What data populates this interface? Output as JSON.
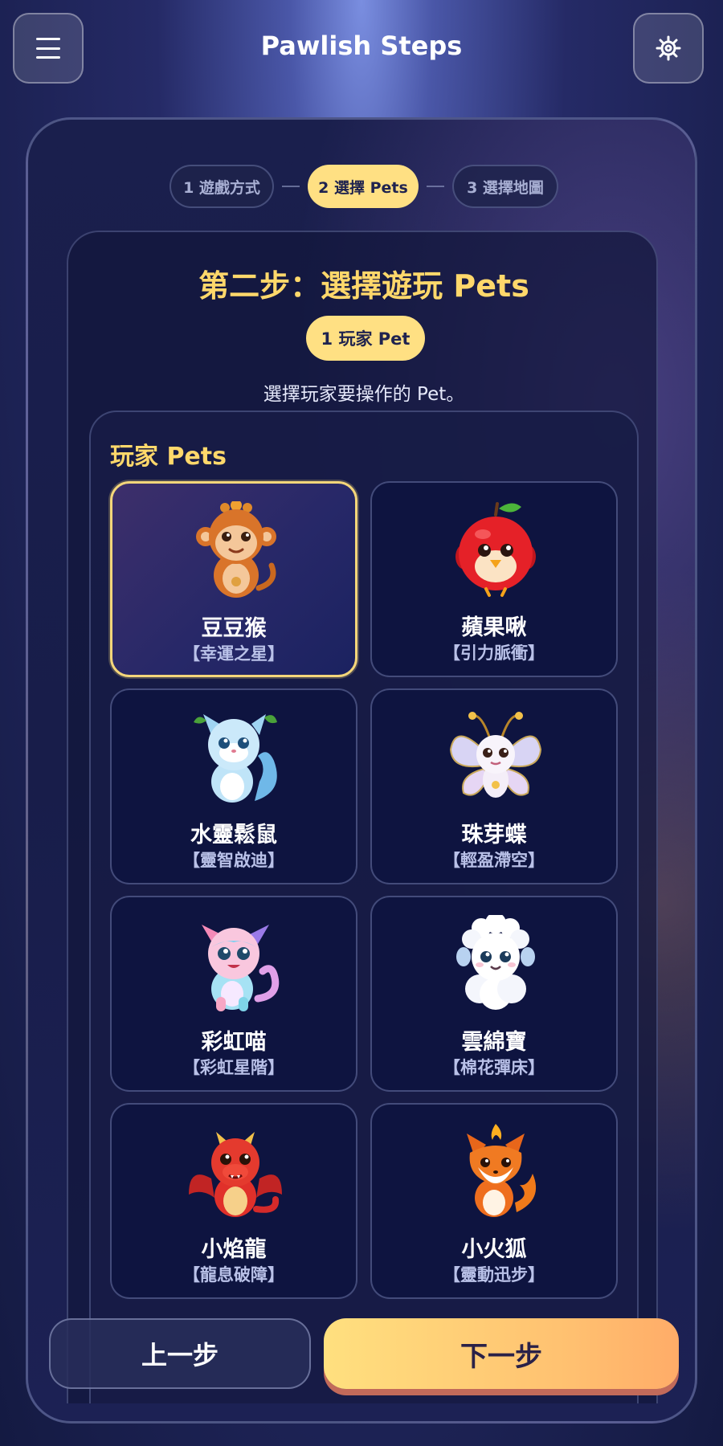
{
  "app": {
    "title": "Pawlish Steps"
  },
  "topbar": {
    "menu_icon": "hamburger-menu-icon",
    "settings_icon": "gear-icon"
  },
  "stepper": {
    "steps": [
      {
        "label": "1 遊戲方式",
        "state": "inactive"
      },
      {
        "label": "2 選擇 Pets",
        "state": "active"
      },
      {
        "label": "3 選擇地圖",
        "state": "inactive"
      }
    ]
  },
  "main": {
    "heading": "第二步：選擇遊玩 Pets",
    "player_count": "1 玩家 Pet",
    "instruction": "選擇玩家要操作的 Pet。",
    "pets_title": "玩家 Pets",
    "pets": [
      {
        "name": "豆豆猴",
        "skill": "【幸運之星】",
        "icon": "monkey-pet-icon",
        "selected": true
      },
      {
        "name": "蘋果啾",
        "skill": "【引力脈衝】",
        "icon": "apple-bird-pet-icon",
        "selected": false
      },
      {
        "name": "水靈鬆鼠",
        "skill": "【靈智啟迪】",
        "icon": "water-squirrel-pet-icon",
        "selected": false
      },
      {
        "name": "珠芽蝶",
        "skill": "【輕盈滯空】",
        "icon": "butterfly-pet-icon",
        "selected": false
      },
      {
        "name": "彩虹喵",
        "skill": "【彩虹星階】",
        "icon": "rainbow-cat-pet-icon",
        "selected": false
      },
      {
        "name": "雲綿寶",
        "skill": "【棉花彈床】",
        "icon": "cloud-sheep-pet-icon",
        "selected": false
      },
      {
        "name": "小焰龍",
        "skill": "【龍息破障】",
        "icon": "fire-dragon-pet-icon",
        "selected": false
      },
      {
        "name": "小火狐",
        "skill": "【靈動迅步】",
        "icon": "fire-fox-pet-icon",
        "selected": false
      }
    ]
  },
  "footer": {
    "prev_label": "上一步",
    "next_label": "下一步"
  },
  "colors": {
    "accent": "#ffe083",
    "heading": "#ffd86b",
    "panel": "#181d4a",
    "card": "#0e1440",
    "selected_border": "#f4d67a"
  }
}
